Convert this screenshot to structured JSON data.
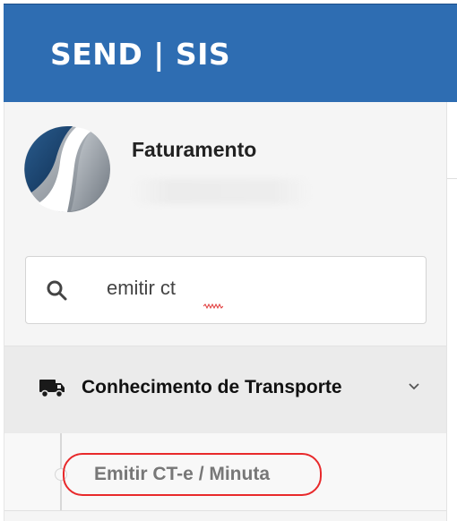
{
  "header": {
    "brand": "SEND | SIS"
  },
  "profile": {
    "title": "Faturamento"
  },
  "search": {
    "value": "emitir ct"
  },
  "menu": {
    "group_label": "Conhecimento de Transporte",
    "sub_items": [
      {
        "label": "Emitir CT-e / Minuta",
        "highlighted": true
      }
    ]
  },
  "icons": {
    "search": "search-icon",
    "truck": "truck-icon",
    "chevron": "chevron-down-icon",
    "logo": "app-logo"
  },
  "colors": {
    "header": "#2e6db2",
    "highlight_outline": "#e8292b",
    "sidebar": "#f5f5f5"
  }
}
